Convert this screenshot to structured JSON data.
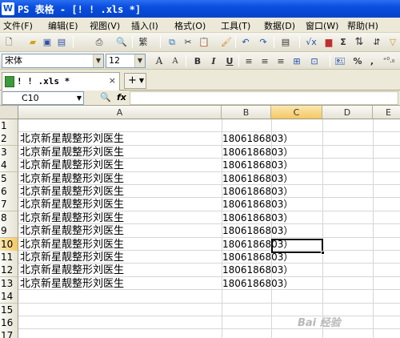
{
  "window": {
    "app_logo": "W",
    "title": "PS 表格 - [! ! .xls *]"
  },
  "menu": [
    "文件(F)",
    "编辑(E)",
    "视图(V)",
    "插入(I)",
    "格式(O)",
    "工具(T)",
    "数据(D)",
    "窗口(W)",
    "帮助(H)"
  ],
  "toolbar": {
    "font_name": "宋体",
    "font_size": "12",
    "bold": "B",
    "italic": "I",
    "underline": "U",
    "grow_font": "A",
    "shrink_font": "A",
    "sum": "Σ",
    "percent": "%",
    "comma": ","
  },
  "tab": {
    "file_name": "! ! .xls *",
    "close": "×",
    "new_tab": "+"
  },
  "formula_bar": {
    "cell_ref": "C10",
    "fx": "fx",
    "value": ""
  },
  "columns": [
    "A",
    "B",
    "C",
    "D",
    "E"
  ],
  "selected_column": "C",
  "rows": [
    {
      "num": "1",
      "a": "",
      "b": ""
    },
    {
      "num": "2",
      "a": "北京新星靓整形刘医生",
      "b": "1806186803）"
    },
    {
      "num": "3",
      "a": "北京新星靓整形刘医生",
      "b": "1806186803）"
    },
    {
      "num": "4",
      "a": "北京新星靓整形刘医生",
      "b": "1806186803）"
    },
    {
      "num": "5",
      "a": "北京新星靓整形刘医生",
      "b": "1806186803）"
    },
    {
      "num": "6",
      "a": "北京新星靓整形刘医生",
      "b": "1806186803）"
    },
    {
      "num": "7",
      "a": "北京新星靓整形刘医生",
      "b": "1806186803）"
    },
    {
      "num": "8",
      "a": "北京新星靓整形刘医生",
      "b": "1806186803）"
    },
    {
      "num": "9",
      "a": "北京新星靓整形刘医生",
      "b": "1806186803）"
    },
    {
      "num": "10",
      "a": "北京新星靓整形刘医生",
      "b": "1806186803）"
    },
    {
      "num": "11",
      "a": "北京新星靓整形刘医生",
      "b": "1806186803）"
    },
    {
      "num": "12",
      "a": "北京新星靓整形刘医生",
      "b": "1806186803）"
    },
    {
      "num": "13",
      "a": "北京新星靓整形刘医生",
      "b": "1806186803）"
    },
    {
      "num": "14",
      "a": "",
      "b": ""
    },
    {
      "num": "15",
      "a": "",
      "b": ""
    },
    {
      "num": "16",
      "a": "",
      "b": ""
    },
    {
      "num": "17",
      "a": "",
      "b": ""
    }
  ],
  "selected_row": "10",
  "watermark": "Bai 经验",
  "colors": {
    "title_bar": "#0a4ee0",
    "chrome": "#ece9d8",
    "selected_header": "#f4c862"
  }
}
